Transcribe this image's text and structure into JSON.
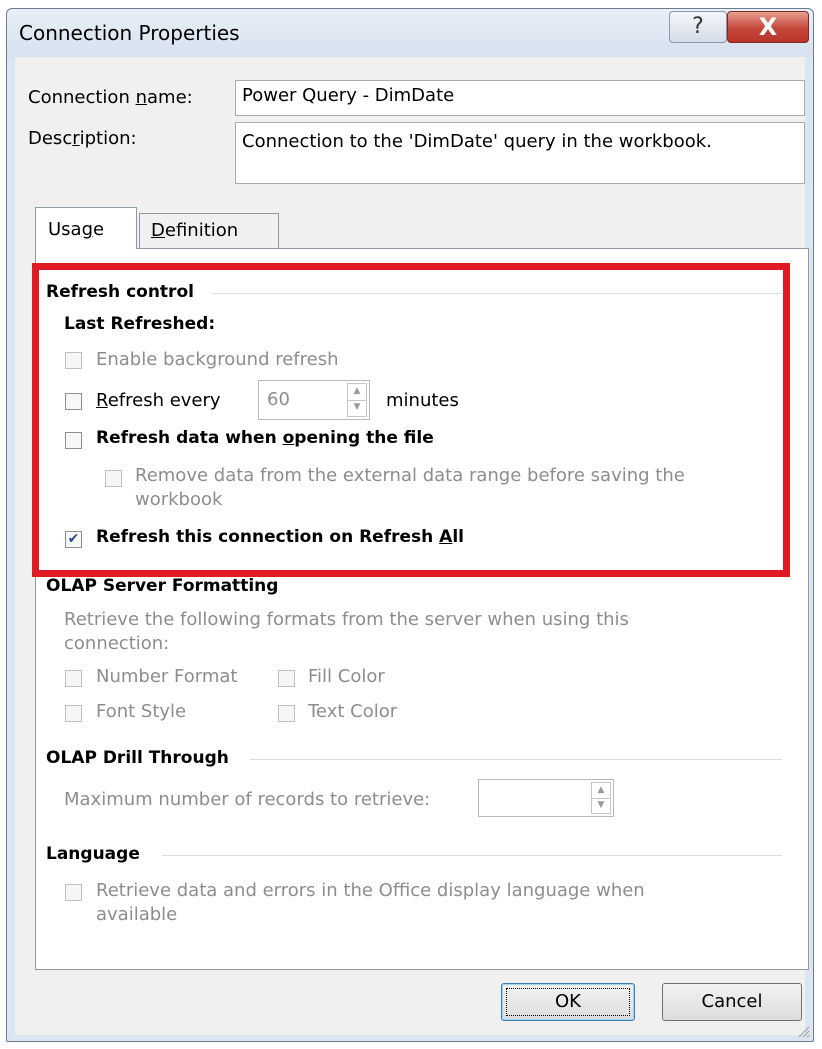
{
  "window": {
    "title": "Connection Properties",
    "help_glyph": "?",
    "close_glyph": "X"
  },
  "form": {
    "connection_name_label": "Connection name:",
    "connection_name_value": "Power Query - DimDate",
    "description_label": "Description:",
    "description_value": "Connection to the 'DimDate' query in the workbook."
  },
  "tabs": [
    {
      "label": "Usage",
      "selected": true
    },
    {
      "label": "Definition",
      "selected": false
    }
  ],
  "refresh_control": {
    "title": "Refresh control",
    "last_refreshed_label": "Last Refreshed:",
    "enable_background": {
      "label": "Enable background refresh",
      "checked": false,
      "enabled": false
    },
    "refresh_every": {
      "label": "Refresh every",
      "value": "60",
      "unit": "minutes",
      "checked": false
    },
    "refresh_on_open": {
      "label": "Refresh data when opening the file",
      "checked": false
    },
    "remove_data": {
      "label_line1": "Remove data from the external data range before saving the",
      "label_line2": "workbook",
      "checked": false,
      "enabled": false
    },
    "refresh_all": {
      "label": "Refresh this connection on Refresh All",
      "checked": true
    }
  },
  "olap_formatting": {
    "title": "OLAP Server Formatting",
    "desc_line1": "Retrieve the following formats from the server when using this",
    "desc_line2": "connection:",
    "options": [
      "Number Format",
      "Fill Color",
      "Font Style",
      "Text Color"
    ]
  },
  "olap_drill": {
    "title": "OLAP Drill Through",
    "max_records_label": "Maximum number of records to retrieve:"
  },
  "language": {
    "title": "Language",
    "label_line1": "Retrieve data and errors in the Office display language when",
    "label_line2": "available"
  },
  "buttons": {
    "ok": "OK",
    "cancel": "Cancel"
  },
  "colors": {
    "highlight_box": "#e01b24",
    "checkmark": "#2a4b8d"
  }
}
